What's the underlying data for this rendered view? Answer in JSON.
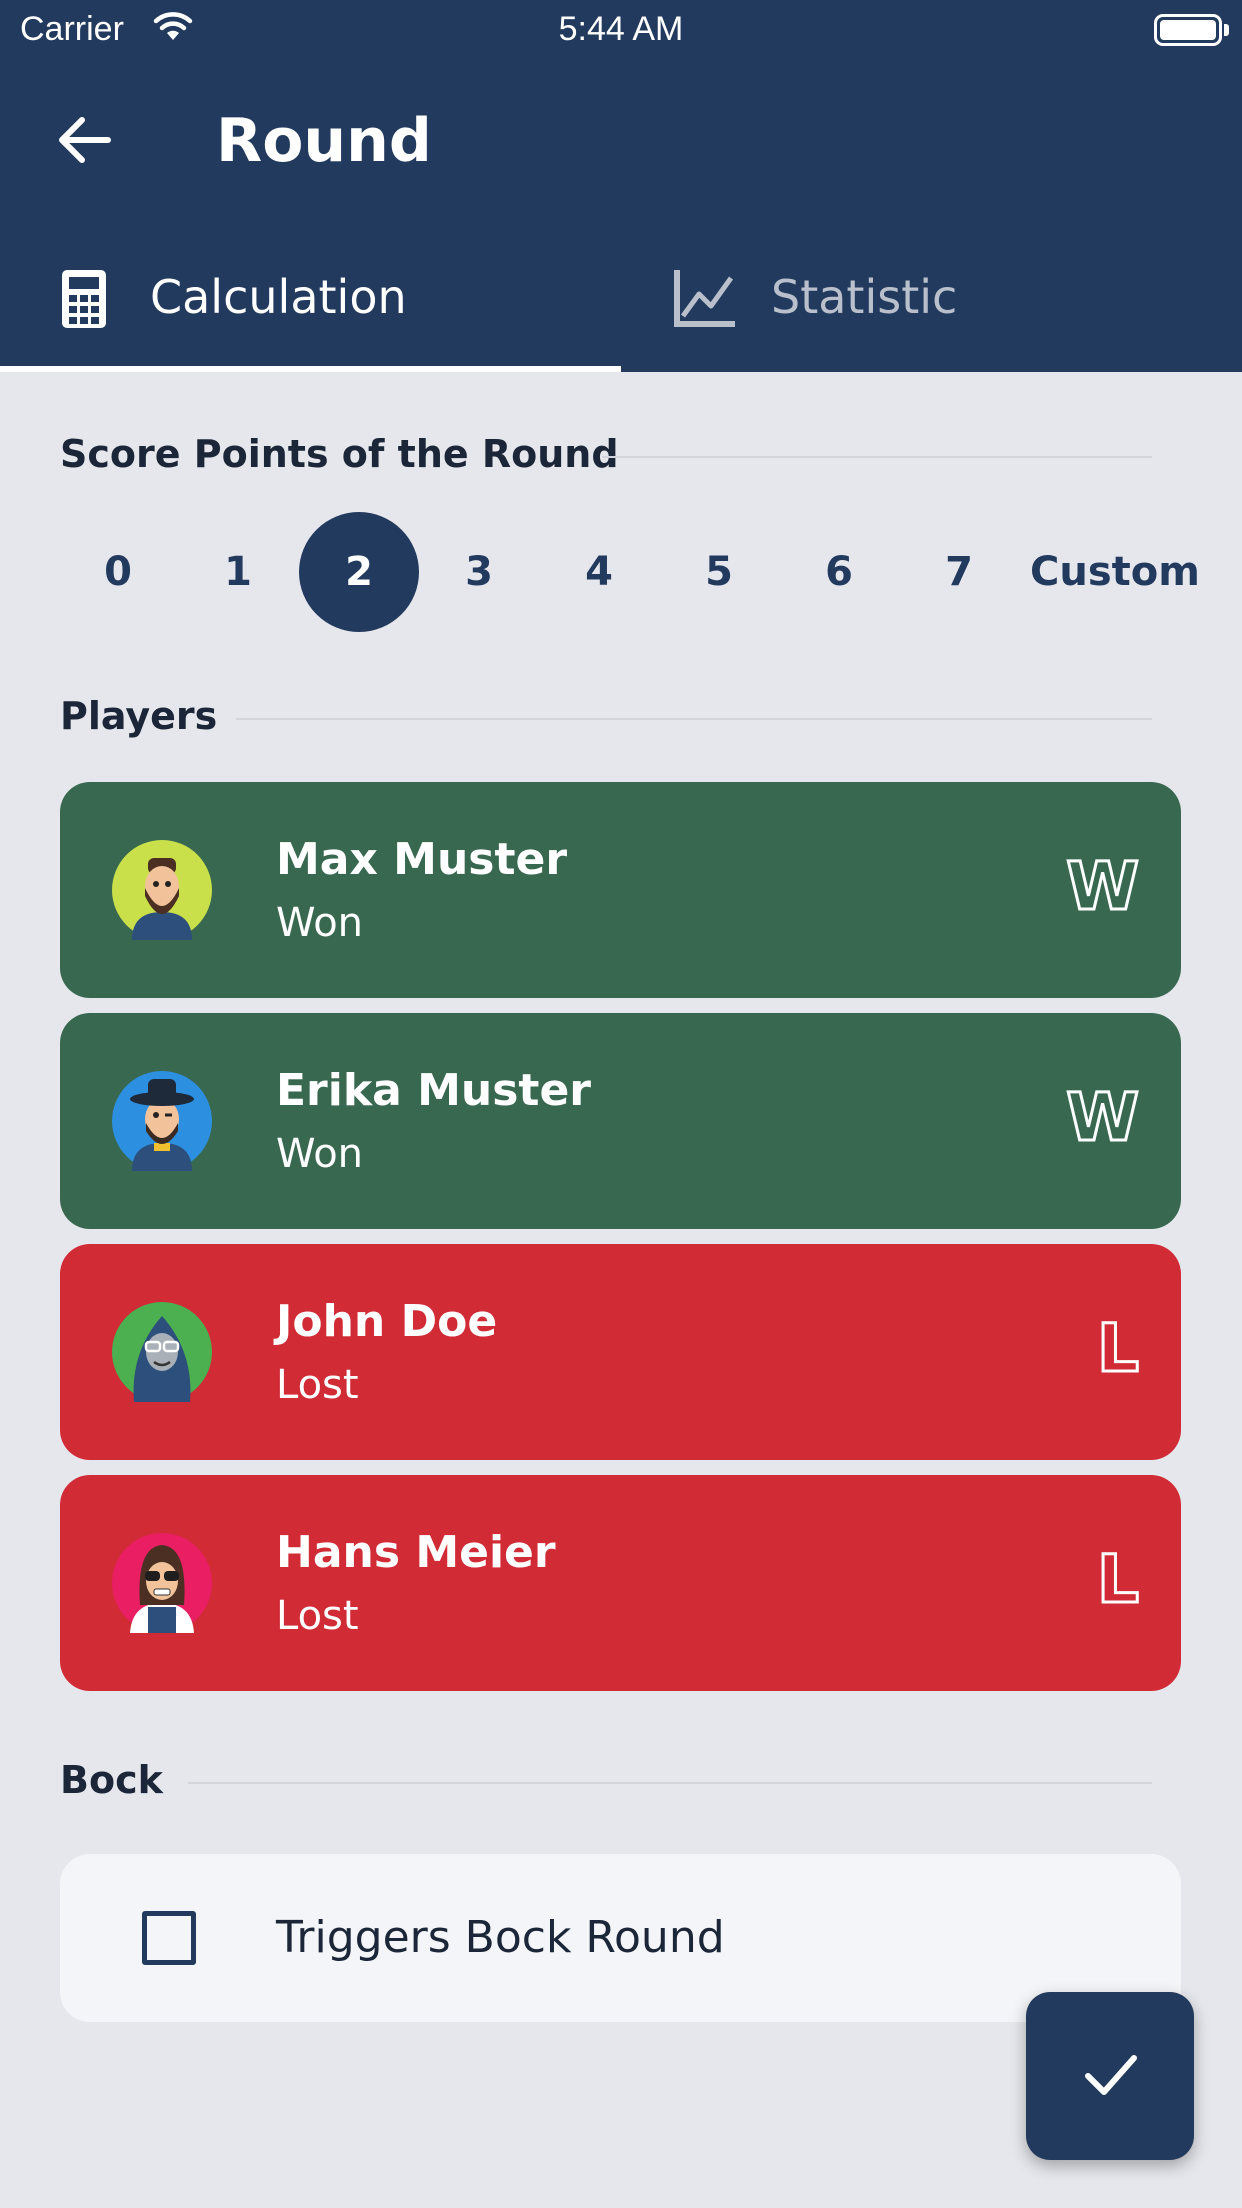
{
  "status_bar": {
    "carrier": "Carrier",
    "time": "5:44 AM"
  },
  "header": {
    "title": "Round"
  },
  "tabs": [
    {
      "label": "Calculation",
      "icon": "calculator-icon",
      "selected": true
    },
    {
      "label": "Statistic",
      "icon": "line-chart-icon",
      "selected": false
    }
  ],
  "score_section": {
    "title": "Score Points of the Round",
    "options": [
      "0",
      "1",
      "2",
      "3",
      "4",
      "5",
      "6",
      "7",
      "Custom"
    ],
    "selected": "2"
  },
  "players_section": {
    "title": "Players",
    "players": [
      {
        "name": "Max Muster",
        "status": "Won",
        "result": "W"
      },
      {
        "name": "Erika Muster",
        "status": "Won",
        "result": "W"
      },
      {
        "name": "John Doe",
        "status": "Lost",
        "result": "L"
      },
      {
        "name": "Hans Meier",
        "status": "Lost",
        "result": "L"
      }
    ]
  },
  "bock_section": {
    "title": "Bock",
    "checkbox_label": "Triggers Bock Round",
    "checked": false
  },
  "colors": {
    "primary": "#223a5e",
    "won": "#386850",
    "lost": "#d12b36",
    "background": "#e6e7ec"
  }
}
